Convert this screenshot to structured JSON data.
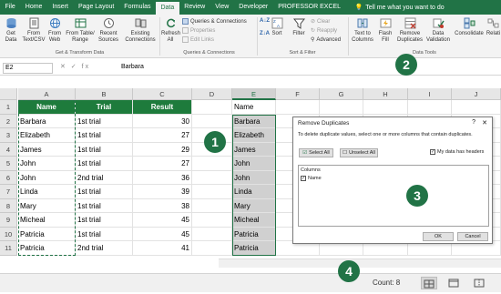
{
  "ribbon_tabs": [
    {
      "label": "File",
      "active": false
    },
    {
      "label": "Home",
      "active": false
    },
    {
      "label": "Insert",
      "active": false
    },
    {
      "label": "Page Layout",
      "active": false
    },
    {
      "label": "Formulas",
      "active": false
    },
    {
      "label": "Data",
      "active": true
    },
    {
      "label": "Review",
      "active": false
    },
    {
      "label": "View",
      "active": false
    },
    {
      "label": "Developer",
      "active": false
    },
    {
      "label": "PROFESSOR EXCEL",
      "active": false
    }
  ],
  "tell_me": "Tell me what you want to do",
  "ribbon": {
    "get_data": "Get\nData",
    "from_text": "From\nText/CSV",
    "from_web": "From\nWeb",
    "from_table": "From Table/\nRange",
    "recent_sources": "Recent\nSources",
    "existing_connections": "Existing\nConnections",
    "refresh_all": "Refresh\nAll",
    "queries_connections": "Queries & Connections",
    "properties": "Properties",
    "edit_links": "Edit Links",
    "sort_az": "A↓Z",
    "sort_za": "Z↓A",
    "sort": "Sort",
    "filter": "Filter",
    "clear": "Clear",
    "reapply": "Reapply",
    "advanced": "Advanced",
    "text_to_columns": "Text to\nColumns",
    "flash_fill": "Flash\nFill",
    "remove_duplicates": "Remove\nDuplicates",
    "data_validation": "Data\nValidation",
    "consolidate": "Consolidate",
    "relations": "Relati",
    "group_get_transform": "Get & Transform Data",
    "group_queries": "Queries & Connections",
    "group_sort_filter": "Sort & Filter",
    "group_data_tools": "Data Tools"
  },
  "formula_bar": {
    "name_box": "E2",
    "fx": "✕ ✓ fx",
    "value": "Barbara"
  },
  "columns": [
    "A",
    "B",
    "C",
    "D",
    "E",
    "F",
    "G",
    "H",
    "I",
    "J"
  ],
  "rows": [
    "1",
    "2",
    "3",
    "4",
    "5",
    "6",
    "7",
    "8",
    "9",
    "10",
    "11"
  ],
  "table": {
    "headers": [
      "Name",
      "Trial",
      "Result"
    ],
    "data": [
      [
        "Barbara",
        "1st trial",
        "30"
      ],
      [
        "Elizabeth",
        "1st trial",
        "27"
      ],
      [
        "James",
        "1st trial",
        "29"
      ],
      [
        "John",
        "1st trial",
        "27"
      ],
      [
        "John",
        "2nd trial",
        "36"
      ],
      [
        "Linda",
        "1st trial",
        "39"
      ],
      [
        "Mary",
        "1st trial",
        "38"
      ],
      [
        "Micheal",
        "1st trial",
        "45"
      ],
      [
        "Patricia",
        "1st trial",
        "45"
      ],
      [
        "Patricia",
        "2nd trial",
        "41"
      ]
    ]
  },
  "column_e": [
    "Name",
    "Barbara",
    "Elizabeth",
    "James",
    "John",
    "John",
    "Linda",
    "Mary",
    "Micheal",
    "Patricia",
    "Patricia"
  ],
  "badges": [
    "1",
    "2",
    "3",
    "4"
  ],
  "dialog": {
    "title": "Remove Duplicates",
    "help": "?",
    "close": "✕",
    "instruction": "To delete duplicate values, select one or more columns that contain duplicates.",
    "select_all": "Select All",
    "unselect_all": "Unselect All",
    "my_data_has_headers": "My data has headers",
    "columns_label": "Columns",
    "column_item": "Name",
    "ok": "OK",
    "cancel": "Cancel"
  },
  "status_bar": {
    "count": "Count: 8"
  },
  "colors": {
    "excel_green": "#217346",
    "header_fill": "#1e7b3c"
  }
}
